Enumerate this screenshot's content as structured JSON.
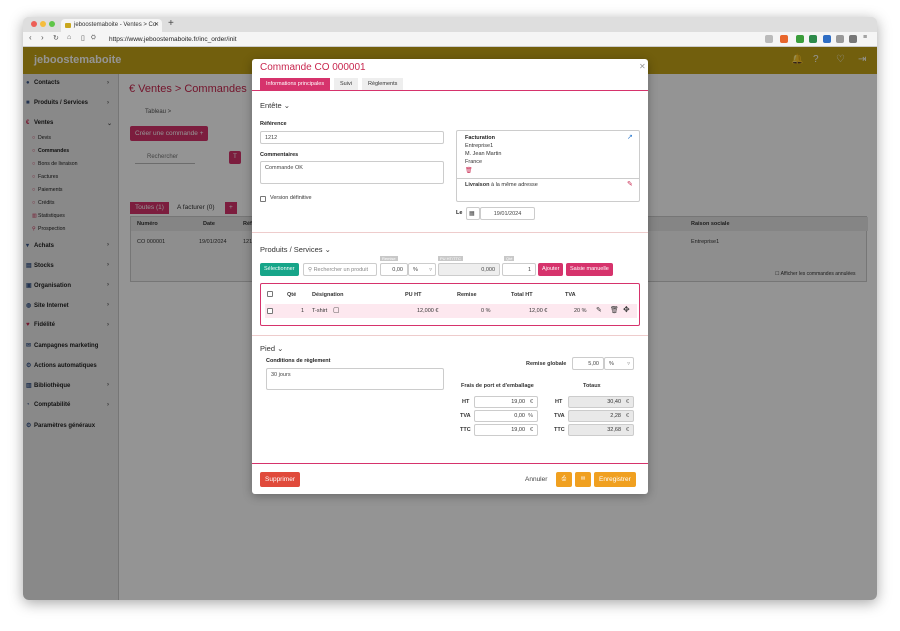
{
  "browser": {
    "tab_title": "jeboostemaboite - Ventes > Co",
    "url": "https://www.jeboostemaboite.fr/inc_order/init"
  },
  "app": {
    "logo": "jeboostemaboite",
    "page_title": "€  Ventes > Commandes",
    "breadcrumb": "Tableau  >",
    "create_button": "Créer une commande  +",
    "search_placeholder": "Rechercher",
    "filter_btn": "T"
  },
  "sidebar": {
    "items": [
      {
        "label": "Contacts",
        "icon": "👥"
      },
      {
        "label": "Produits / Services",
        "icon": "▦"
      },
      {
        "label": "Ventes",
        "icon": "€"
      }
    ],
    "sub": [
      "Devis",
      "Commandes",
      "Bons de livraison",
      "Factures",
      "Paiements",
      "Crédits",
      "Statistiques",
      "Prospection"
    ],
    "items2": [
      {
        "label": "Achats",
        "icon": "🛒"
      },
      {
        "label": "Stocks",
        "icon": "▤"
      },
      {
        "label": "Organisation",
        "icon": "▣"
      },
      {
        "label": "Site Internet",
        "icon": "◍"
      },
      {
        "label": "Fidélité",
        "icon": "♥"
      },
      {
        "label": "Campagnes marketing",
        "icon": "✉"
      },
      {
        "label": "Actions automatiques",
        "icon": "⚙"
      },
      {
        "label": "Bibliothèque",
        "icon": "▥"
      },
      {
        "label": "Comptabilité",
        "icon": "◔"
      },
      {
        "label": "Paramètres généraux",
        "icon": "⚙"
      }
    ]
  },
  "list": {
    "tab_all": "Toutes (1)",
    "tab_invoice": "A facturer (0)",
    "add_tab": "+",
    "headers": {
      "numero": "Numéro",
      "date": "Date",
      "ref": "Réf",
      "raison": "Raison sociale"
    },
    "row": {
      "numero": "CO 000001",
      "date": "19/01/2024",
      "ref": "121",
      "raison": "Entreprise1"
    },
    "show_deleted": "Afficher les commandes annulées"
  },
  "modal": {
    "title": "Commande CO 000001",
    "tabs": [
      "Informations principales",
      "Suivi",
      "Règlements"
    ],
    "entete": "Entête",
    "reference_label": "Référence",
    "reference_value": "1212",
    "comments_label": "Commentaires",
    "comments_value": "Commande OK",
    "final_version": "Version définitive",
    "billing_title": "Facturation",
    "billing_lines": [
      "Entreprise1",
      "M. Jean Martin",
      "France"
    ],
    "delivery_label": "Livraison",
    "delivery_text": " à la même adresse",
    "date_label": "Le",
    "date_value": "19/01/2024",
    "products_title": "Produits / Services",
    "select_btn": "Sélectionner",
    "product_placeholder": "Rechercher un produit",
    "price_value": "0,00",
    "unit": "%",
    "total_value": "0,000",
    "qty_value": "1",
    "small_labels": [
      "Remise",
      "PU HT/TTC",
      "Qté"
    ],
    "add_btn": "Ajouter",
    "manual_btn": "Saisie manuelle",
    "table_headers": {
      "qte": "Qté",
      "designation": "Désignation",
      "pu": "PU HT",
      "remise": "Remise",
      "total": "Total HT",
      "tva": "TVA"
    },
    "line": {
      "qte": "1",
      "designation": "T-shirt",
      "pu": "12,000 €",
      "remise": "0 %",
      "total": "12,00 €",
      "tva": "20 %"
    },
    "pied": "Pied",
    "conditions_label": "Conditions de règlement",
    "conditions_value": "30 jours",
    "remise_globale_label": "Remise globale",
    "remise_globale_value": "5,00",
    "remise_unit": "%",
    "frais_title": "Frais de port et d'emballage",
    "totaux_title": "Totaux",
    "frais": [
      {
        "label": "HT",
        "value": "19,00",
        "unit": "€"
      },
      {
        "label": "TVA",
        "value": "0,00",
        "unit": "%"
      },
      {
        "label": "TTC",
        "value": "19,00",
        "unit": "€"
      }
    ],
    "totaux": [
      {
        "label": "HT",
        "value": "30,40",
        "unit": "€"
      },
      {
        "label": "TVA",
        "value": "2,28",
        "unit": "€"
      },
      {
        "label": "TTC",
        "value": "32,68",
        "unit": "€"
      }
    ],
    "delete_btn": "Supprimer",
    "cancel_btn": "Annuler",
    "save_btn": "Enregistrer"
  },
  "colors": {
    "accent": "#d6336c",
    "topbar": "#c4a418",
    "action_orange": "#f0a020"
  }
}
